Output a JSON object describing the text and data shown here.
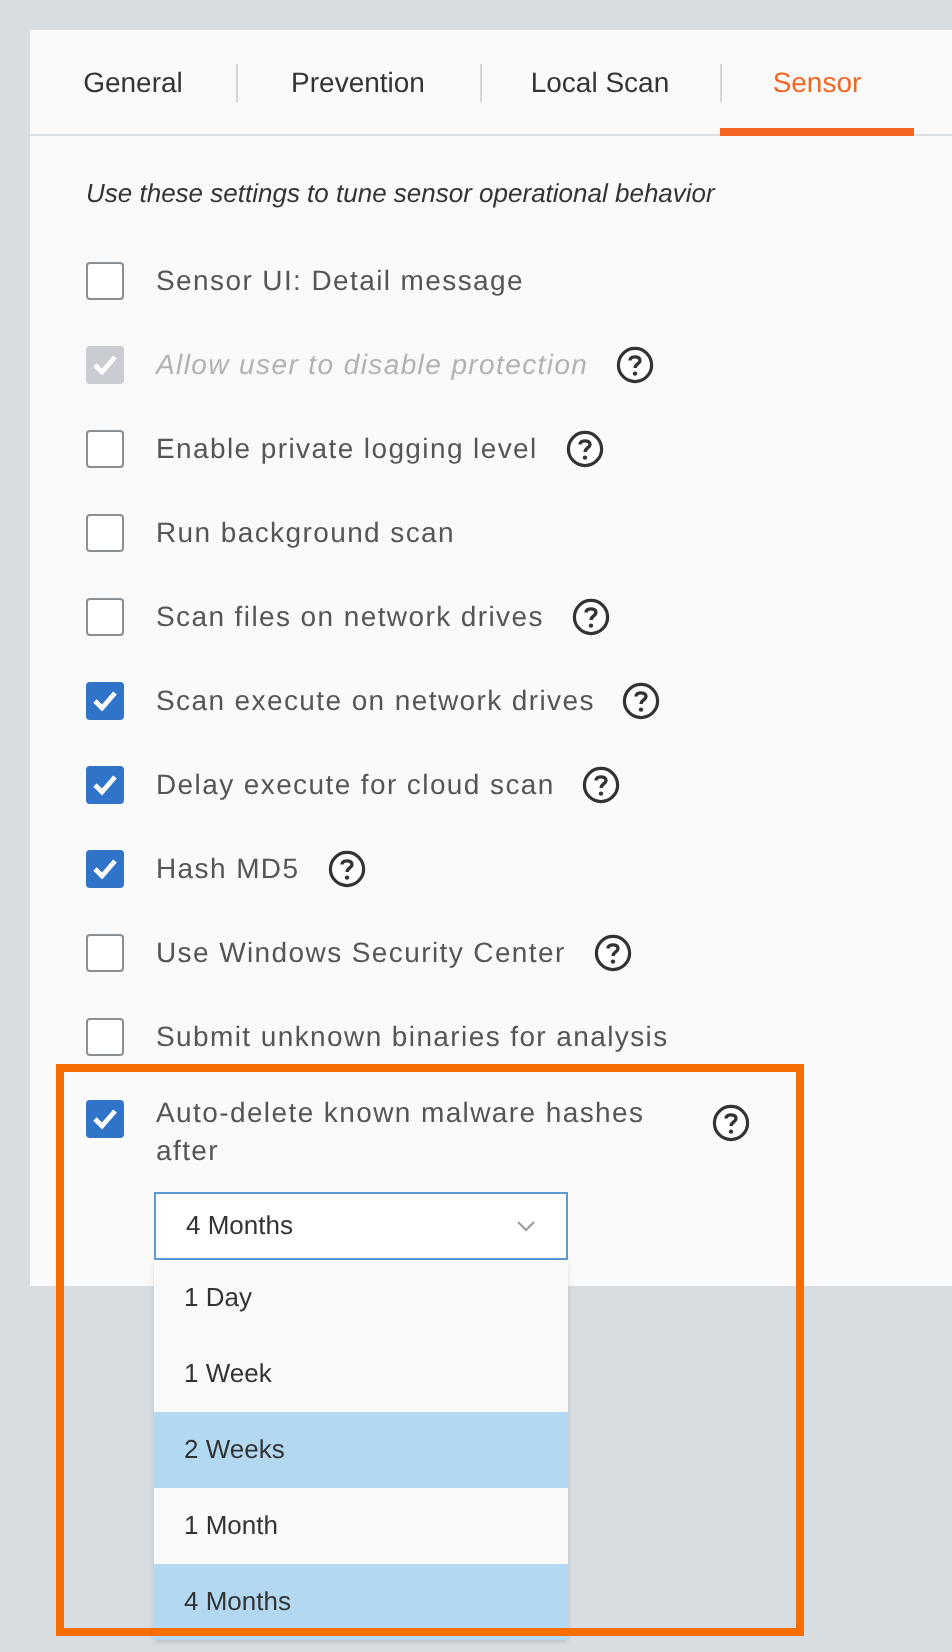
{
  "tabs": [
    {
      "label": "General",
      "selected": false
    },
    {
      "label": "Prevention",
      "selected": false
    },
    {
      "label": "Local Scan",
      "selected": false
    },
    {
      "label": "Sensor",
      "selected": true
    }
  ],
  "intro": "Use these settings to tune sensor operational behavior",
  "settings": [
    {
      "label": "Sensor UI: Detail message",
      "checked": false,
      "disabled": false,
      "help": false
    },
    {
      "label": "Allow user to disable protection",
      "checked": true,
      "disabled": true,
      "help": true
    },
    {
      "label": "Enable private logging level",
      "checked": false,
      "disabled": false,
      "help": true
    },
    {
      "label": "Run background scan",
      "checked": false,
      "disabled": false,
      "help": false
    },
    {
      "label": "Scan files on network drives",
      "checked": false,
      "disabled": false,
      "help": true
    },
    {
      "label": "Scan execute on network drives",
      "checked": true,
      "disabled": false,
      "help": true
    },
    {
      "label": "Delay execute for cloud scan",
      "checked": true,
      "disabled": false,
      "help": true
    },
    {
      "label": "Hash MD5",
      "checked": true,
      "disabled": false,
      "help": true
    },
    {
      "label": "Use Windows Security Center",
      "checked": false,
      "disabled": false,
      "help": true
    },
    {
      "label": "Submit unknown binaries for analysis",
      "checked": false,
      "disabled": false,
      "help": false
    }
  ],
  "auto_delete": {
    "label": "Auto-delete known malware hashes after",
    "checked": true,
    "help": true,
    "outlined": true,
    "dropdown": {
      "value": "4 Months",
      "expanded": true,
      "options": [
        {
          "label": "1 Day",
          "highlighted": false
        },
        {
          "label": "1 Week",
          "highlighted": false
        },
        {
          "label": "2 Weeks",
          "highlighted": true
        },
        {
          "label": "1 Month",
          "highlighted": false
        },
        {
          "label": "4 Months",
          "highlighted": true
        }
      ]
    }
  }
}
